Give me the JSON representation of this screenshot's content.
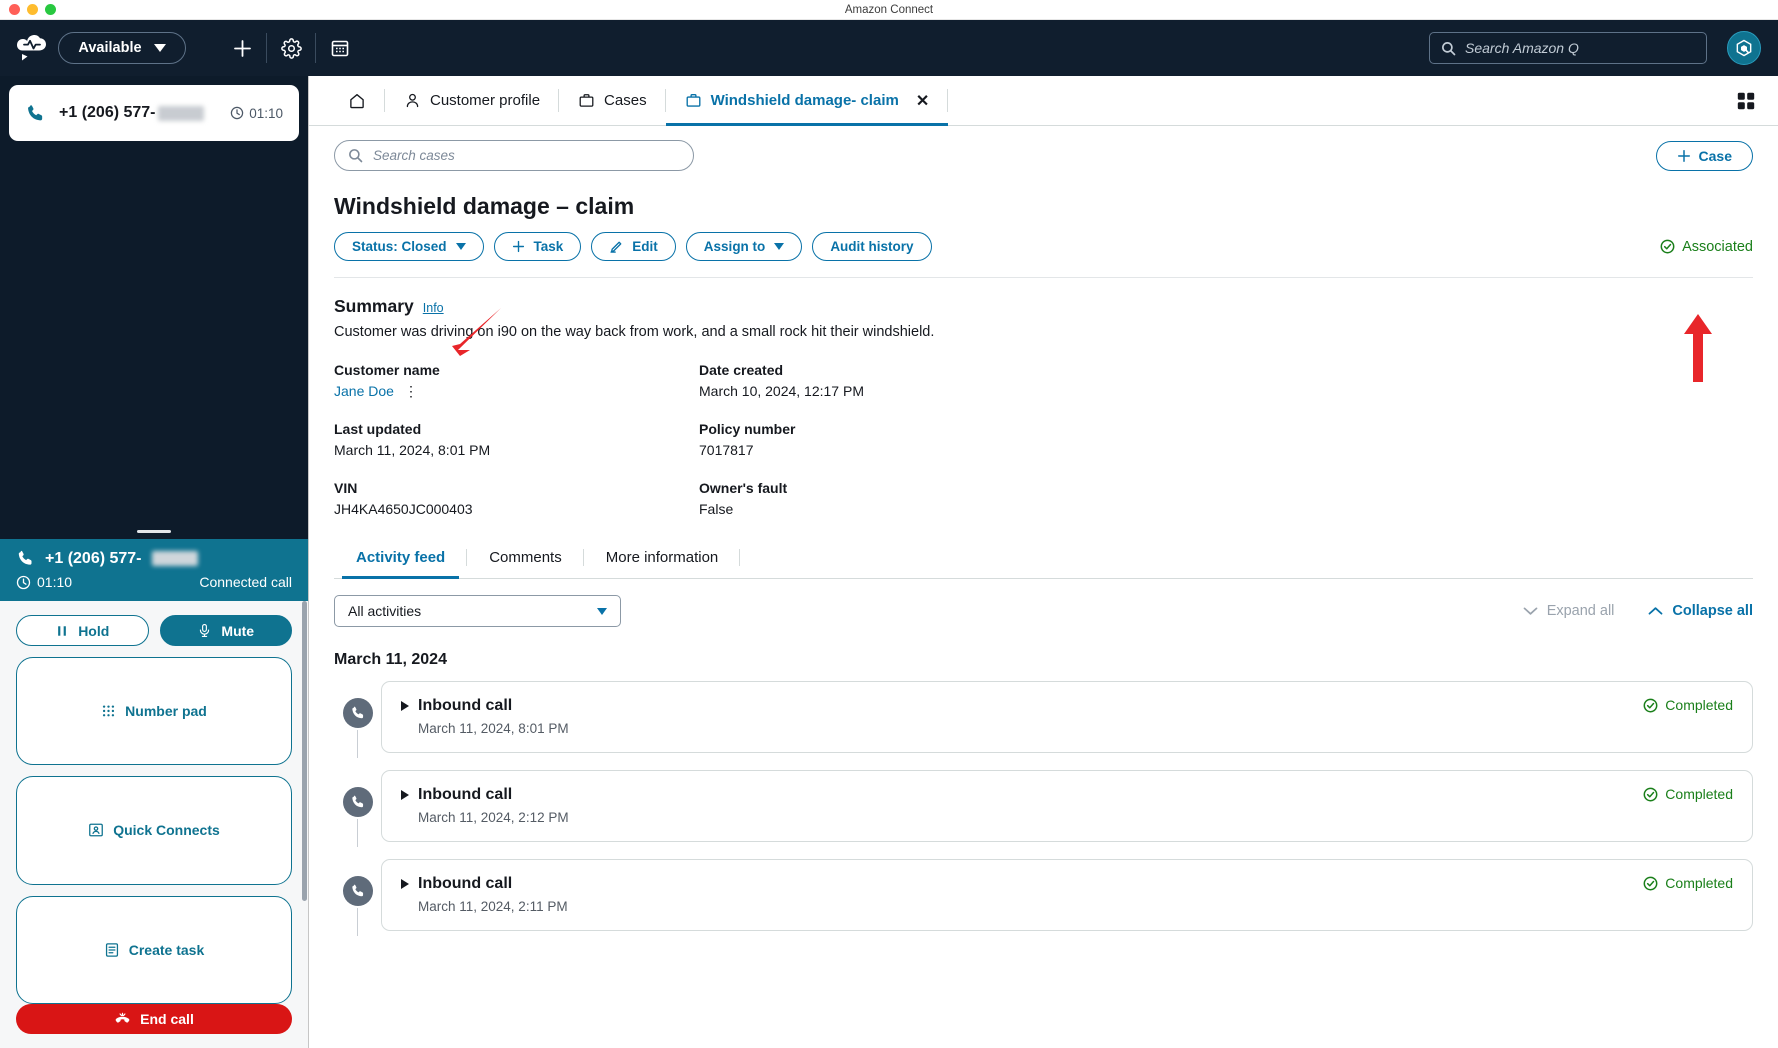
{
  "window": {
    "title": "Amazon Connect"
  },
  "topbar": {
    "status_label": "Available",
    "add_icon": "plus-icon",
    "settings_icon": "gear-icon",
    "calendar_icon": "calendar-icon",
    "search_placeholder": "Search Amazon Q",
    "avatar_icon": "amazon-q-avatar",
    "accent": "#0f7390",
    "background": "#101e2e"
  },
  "ccp": {
    "contact_card": {
      "number": "+1 (206) 577-",
      "timer": "01:10"
    },
    "call": {
      "number": "+1 (206) 577-",
      "timer": "01:10",
      "state": "Connected call"
    },
    "buttons": {
      "hold": "Hold",
      "mute": "Mute",
      "number_pad": "Number pad",
      "quick_connects": "Quick Connects",
      "create_task": "Create task",
      "end_call": "End call"
    }
  },
  "tabs": [
    {
      "label": "",
      "icon": "home-icon",
      "active": false
    },
    {
      "label": "Customer profile",
      "icon": "person-icon",
      "active": false
    },
    {
      "label": "Cases",
      "icon": "briefcase-icon",
      "active": false
    },
    {
      "label": "Windshield damage- claim",
      "icon": "briefcase-icon",
      "active": true,
      "closable": true
    }
  ],
  "toolbar": {
    "search_placeholder": "Search cases",
    "case_button": "Case"
  },
  "case": {
    "title": "Windshield damage – claim",
    "actions": [
      {
        "label": "Status: Closed",
        "caret": true
      },
      {
        "label": "Task",
        "plus": true
      },
      {
        "label": "Edit",
        "pencil": true
      },
      {
        "label": "Assign to",
        "caret": true
      },
      {
        "label": "Audit history"
      }
    ],
    "associated_label": "Associated",
    "summary_heading": "Summary",
    "info_label": "Info",
    "summary_text": "Customer was driving on i90 on the way back from work, and a small rock hit their windshield.",
    "fields": [
      [
        {
          "label": "Customer name",
          "value": "Jane Doe",
          "is_link": true
        },
        {
          "label": "Date created",
          "value": "March 10, 2024, 12:17 PM",
          "is_link": false
        }
      ],
      [
        {
          "label": "Last updated",
          "value": "March 11, 2024, 8:01 PM",
          "is_link": false
        },
        {
          "label": "Policy number",
          "value": "7017817",
          "is_link": false
        }
      ],
      [
        {
          "label": "VIN",
          "value": "JH4KA4650JC000403",
          "is_link": false
        },
        {
          "label": "Owner's fault",
          "value": "False",
          "is_link": false
        }
      ]
    ]
  },
  "feed": {
    "tabs": [
      {
        "label": "Activity feed",
        "active": true
      },
      {
        "label": "Comments",
        "active": false
      },
      {
        "label": "More information",
        "active": false
      }
    ],
    "filter_value": "All activities",
    "expand_all": "Expand all",
    "collapse_all": "Collapse all",
    "date_group": "March 11, 2024",
    "items": [
      {
        "title": "Inbound call",
        "timestamp": "March 11, 2024, 8:01 PM",
        "status": "Completed",
        "icon": "phone-icon"
      },
      {
        "title": "Inbound call",
        "timestamp": "March 11, 2024, 2:12 PM",
        "status": "Completed",
        "icon": "phone-icon"
      },
      {
        "title": "Inbound call",
        "timestamp": "March 11, 2024, 2:11 PM",
        "status": "Completed",
        "icon": "phone-icon"
      }
    ]
  },
  "colors": {
    "link": "#0972a8",
    "success": "#1a7f1a",
    "danger": "#d91515",
    "teal": "#0f7390"
  }
}
